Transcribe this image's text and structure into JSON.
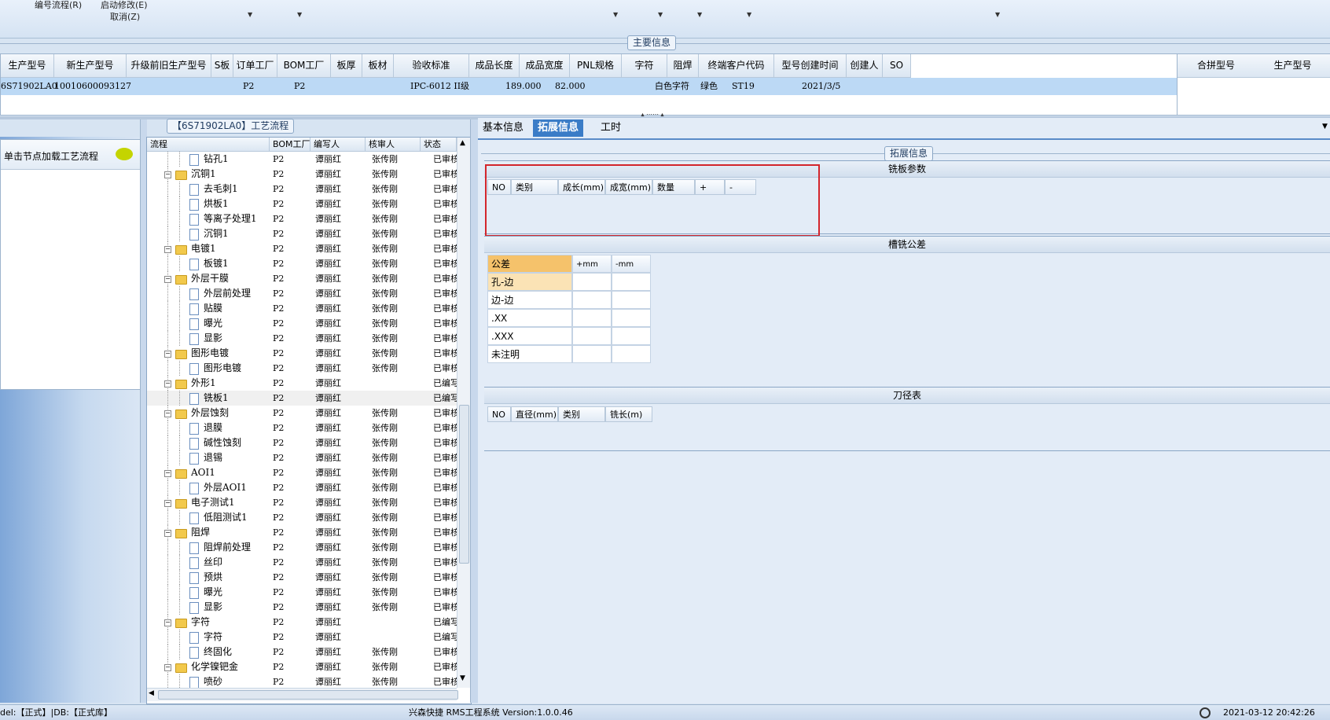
{
  "toolbar": {
    "item1": "编号流程(R)",
    "item2": "启动修改(E)",
    "item3": "取消(Z)"
  },
  "main_info": {
    "title": "主要信息",
    "columns": [
      "生产型号",
      "新生产型号",
      "升级前旧生产型号",
      "S板",
      "订单工厂",
      "BOM工厂",
      "板厚",
      "板材",
      "验收标准",
      "成品长度",
      "成品宽度",
      "PNL规格",
      "字符",
      "阻焊",
      "终端客户代码",
      "型号创建时间",
      "创建人",
      "SO"
    ],
    "row": {
      "c1": "6S71902LA0",
      "c2": "10010600093127",
      "c5": "P2",
      "c6": "P2",
      "c9": "IPC-6012 II级",
      "c10": "189.000",
      "c11": "82.000",
      "c13": "白色字符",
      "c14": "绿色",
      "c15": "ST19",
      "c16": "2021/3/5"
    }
  },
  "merge_grid": {
    "col1": "合拼型号",
    "col2": "生产型号"
  },
  "left_panel": {
    "hint": "单击节点加载工艺流程"
  },
  "process": {
    "title": "【6S71902LA0】工艺流程",
    "columns": [
      "流程",
      "BOM工厂",
      "编写人",
      "核审人",
      "状态"
    ],
    "rows": [
      {
        "name": "钻孔1",
        "level": 2,
        "bom": "P2",
        "writer": "谭丽红",
        "reviewer": "张传刚",
        "status": "已审核"
      },
      {
        "name": "沉铜1",
        "level": 1,
        "bom": "P2",
        "writer": "谭丽红",
        "reviewer": "张传刚",
        "status": "已审核"
      },
      {
        "name": "去毛刺1",
        "level": 2,
        "bom": "P2",
        "writer": "谭丽红",
        "reviewer": "张传刚",
        "status": "已审核"
      },
      {
        "name": "烘板1",
        "level": 2,
        "bom": "P2",
        "writer": "谭丽红",
        "reviewer": "张传刚",
        "status": "已审核"
      },
      {
        "name": "等离子处理1",
        "level": 2,
        "bom": "P2",
        "writer": "谭丽红",
        "reviewer": "张传刚",
        "status": "已审核"
      },
      {
        "name": "沉铜1",
        "level": 2,
        "bom": "P2",
        "writer": "谭丽红",
        "reviewer": "张传刚",
        "status": "已审核"
      },
      {
        "name": "电镀1",
        "level": 1,
        "bom": "P2",
        "writer": "谭丽红",
        "reviewer": "张传刚",
        "status": "已审核"
      },
      {
        "name": "板镀1",
        "level": 2,
        "bom": "P2",
        "writer": "谭丽红",
        "reviewer": "张传刚",
        "status": "已审核"
      },
      {
        "name": "外层干膜",
        "level": 1,
        "bom": "P2",
        "writer": "谭丽红",
        "reviewer": "张传刚",
        "status": "已审核"
      },
      {
        "name": "外层前处理",
        "level": 2,
        "bom": "P2",
        "writer": "谭丽红",
        "reviewer": "张传刚",
        "status": "已审核"
      },
      {
        "name": "贴膜",
        "level": 2,
        "bom": "P2",
        "writer": "谭丽红",
        "reviewer": "张传刚",
        "status": "已审核"
      },
      {
        "name": "曝光",
        "level": 2,
        "bom": "P2",
        "writer": "谭丽红",
        "reviewer": "张传刚",
        "status": "已审核"
      },
      {
        "name": "显影",
        "level": 2,
        "bom": "P2",
        "writer": "谭丽红",
        "reviewer": "张传刚",
        "status": "已审核"
      },
      {
        "name": "图形电镀",
        "level": 1,
        "bom": "P2",
        "writer": "谭丽红",
        "reviewer": "张传刚",
        "status": "已审核"
      },
      {
        "name": "图形电镀",
        "level": 2,
        "bom": "P2",
        "writer": "谭丽红",
        "reviewer": "张传刚",
        "status": "已审核"
      },
      {
        "name": "外形1",
        "level": 1,
        "bom": "P2",
        "writer": "谭丽红",
        "reviewer": "",
        "status": "已编写"
      },
      {
        "name": "铣板1",
        "level": 2,
        "bom": "P2",
        "writer": "谭丽红",
        "reviewer": "",
        "status": "已编写"
      },
      {
        "name": "外层蚀刻",
        "level": 1,
        "bom": "P2",
        "writer": "谭丽红",
        "reviewer": "张传刚",
        "status": "已审核"
      },
      {
        "name": "退膜",
        "level": 2,
        "bom": "P2",
        "writer": "谭丽红",
        "reviewer": "张传刚",
        "status": "已审核"
      },
      {
        "name": "碱性蚀刻",
        "level": 2,
        "bom": "P2",
        "writer": "谭丽红",
        "reviewer": "张传刚",
        "status": "已审核"
      },
      {
        "name": "退锡",
        "level": 2,
        "bom": "P2",
        "writer": "谭丽红",
        "reviewer": "张传刚",
        "status": "已审核"
      },
      {
        "name": "AOI1",
        "level": 1,
        "bom": "P2",
        "writer": "谭丽红",
        "reviewer": "张传刚",
        "status": "已审核"
      },
      {
        "name": "外层AOI1",
        "level": 2,
        "bom": "P2",
        "writer": "谭丽红",
        "reviewer": "张传刚",
        "status": "已审核"
      },
      {
        "name": "电子测试1",
        "level": 1,
        "bom": "P2",
        "writer": "谭丽红",
        "reviewer": "张传刚",
        "status": "已审核"
      },
      {
        "name": "低阻测试1",
        "level": 2,
        "bom": "P2",
        "writer": "谭丽红",
        "reviewer": "张传刚",
        "status": "已审核"
      },
      {
        "name": "阻焊",
        "level": 1,
        "bom": "P2",
        "writer": "谭丽红",
        "reviewer": "张传刚",
        "status": "已审核"
      },
      {
        "name": "阻焊前处理",
        "level": 2,
        "bom": "P2",
        "writer": "谭丽红",
        "reviewer": "张传刚",
        "status": "已审核"
      },
      {
        "name": "丝印",
        "level": 2,
        "bom": "P2",
        "writer": "谭丽红",
        "reviewer": "张传刚",
        "status": "已审核"
      },
      {
        "name": "预烘",
        "level": 2,
        "bom": "P2",
        "writer": "谭丽红",
        "reviewer": "张传刚",
        "status": "已审核"
      },
      {
        "name": "曝光",
        "level": 2,
        "bom": "P2",
        "writer": "谭丽红",
        "reviewer": "张传刚",
        "status": "已审核"
      },
      {
        "name": "显影",
        "level": 2,
        "bom": "P2",
        "writer": "谭丽红",
        "reviewer": "张传刚",
        "status": "已审核"
      },
      {
        "name": "字符",
        "level": 1,
        "bom": "P2",
        "writer": "谭丽红",
        "reviewer": "",
        "status": "已编写"
      },
      {
        "name": "字符",
        "level": 2,
        "bom": "P2",
        "writer": "谭丽红",
        "reviewer": "",
        "status": "已编写"
      },
      {
        "name": "终固化",
        "level": 2,
        "bom": "P2",
        "writer": "谭丽红",
        "reviewer": "张传刚",
        "status": "已审核"
      },
      {
        "name": "化学镍钯金",
        "level": 1,
        "bom": "P2",
        "writer": "谭丽红",
        "reviewer": "张传刚",
        "status": "已审核"
      },
      {
        "name": "喷砂",
        "level": 2,
        "bom": "P2",
        "writer": "谭丽红",
        "reviewer": "张传刚",
        "status": "已审核"
      }
    ]
  },
  "tabs": {
    "basic": "基本信息",
    "extended": "拓展信息",
    "hours": "工时"
  },
  "extended": {
    "title": "拓展信息",
    "mill_params": {
      "title": "铣板参数",
      "columns": [
        "NO",
        "类别",
        "成长(mm)",
        "成宽(mm)",
        "数量",
        "+",
        "-"
      ]
    },
    "tolerance": {
      "title": "槽铣公差",
      "columns": [
        "公差",
        "+mm",
        "-mm"
      ],
      "rows": [
        "孔-边",
        "边-边",
        ".XX",
        ".XXX",
        "未注明"
      ]
    },
    "tool_table": {
      "title": "刀径表",
      "columns": [
        "NO",
        "直径(mm)",
        "类别",
        "铣长(m)"
      ]
    }
  },
  "status": {
    "left": "del:【正式】|DB:【正式库】",
    "center": "兴森快捷 RMS工程系统 Version:1.0.0.46",
    "time": "2021-03-12 20:42:26"
  }
}
